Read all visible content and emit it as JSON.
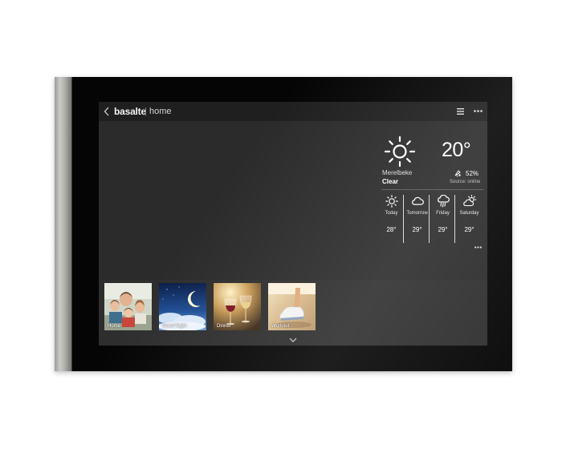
{
  "topbar": {
    "brand": "basalte",
    "separator": "|",
    "subtitle": "home",
    "icons": [
      "back-icon",
      "menu-icon",
      "more-icon"
    ]
  },
  "weather": {
    "current": {
      "icon": "sun-icon",
      "temperature": "20°",
      "location": "Merelbeke",
      "condition": "Clear",
      "humidity": "52%",
      "humidity_icon": "humidity-icon",
      "source": "Source: online"
    },
    "forecast": [
      {
        "day": "Today",
        "temp": "28°",
        "icon": "sun-icon"
      },
      {
        "day": "Tomorrow",
        "temp": "29°",
        "icon": "cloud-icon"
      },
      {
        "day": "Friday",
        "temp": "29°",
        "icon": "rain-icon"
      },
      {
        "day": "Saturday",
        "temp": "29°",
        "icon": "partly-cloudy-icon"
      }
    ]
  },
  "scenes": [
    {
      "label": "Home",
      "image": "family-photo"
    },
    {
      "label": "Good Night",
      "image": "moon-clouds-photo"
    },
    {
      "label": "Dinner",
      "image": "wine-glasses-photo"
    },
    {
      "label": "Workout",
      "image": "running-shoe-photo"
    }
  ],
  "colors": {
    "screen_background": "#2b2b2b",
    "topbar_background": "#1f1f1f",
    "text_primary": "#ffffff",
    "bezel": "#000000",
    "edge_metal": "#b2b2ae"
  }
}
